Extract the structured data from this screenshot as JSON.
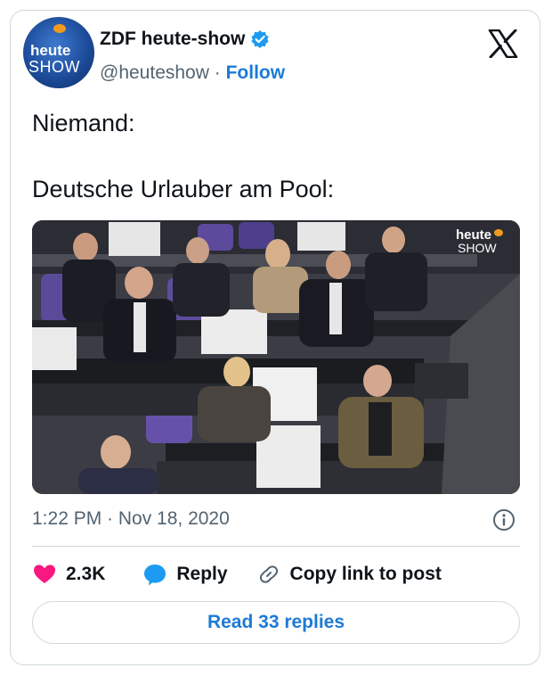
{
  "author": {
    "name": "ZDF heute-show",
    "handle": "@heuteshow",
    "separator": "·",
    "follow_label": "Follow",
    "avatar_text_line1": "heute",
    "avatar_text_line2": "SHOW",
    "verified_color": "#1d9bf0"
  },
  "tweet": {
    "text": "Niemand:\n\nDeutsche Urlauber am Pool:",
    "timestamp": "1:22 PM · Nov 18, 2020"
  },
  "media": {
    "watermark_line1": "heute",
    "watermark_line2": "SHOW",
    "description_icon": "photo"
  },
  "actions": {
    "like_count": "2.3K",
    "reply_label": "Reply",
    "copy_link_label": "Copy link to post",
    "like_color": "#f91880",
    "accent_color": "#1d7bd6"
  },
  "footer": {
    "read_replies_label": "Read 33 replies"
  }
}
